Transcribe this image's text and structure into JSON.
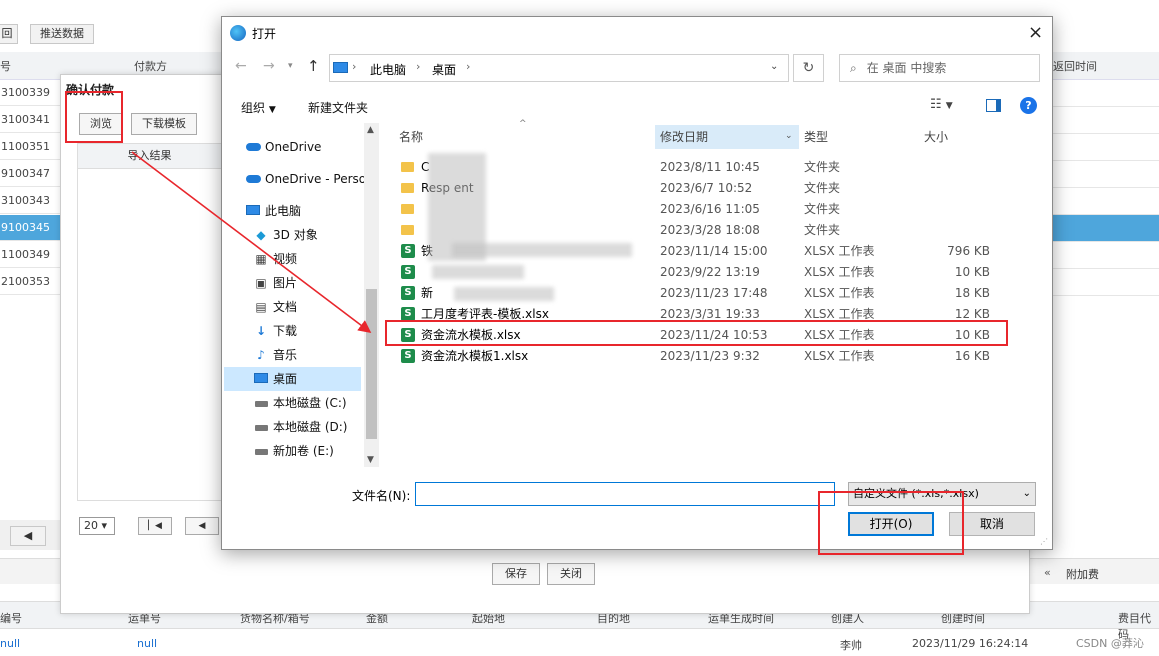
{
  "background": {
    "toolbar": {
      "back_label": "回",
      "push_label": "推送数据"
    },
    "header": {
      "col_no": "号",
      "col_payer": "付款方",
      "col_return_time": "返回时间"
    },
    "rows": [
      "3100339",
      "3100341",
      "1100351",
      "9100347",
      "3100343",
      "9100345",
      "1100349",
      "2100353"
    ],
    "selected_row_index": 5,
    "bottom_header": {
      "c1": "编号",
      "c2": "运单号",
      "c3": "货物名称/箱号",
      "c4": "金额",
      "c5": "起始地",
      "c6": "目的地",
      "c7": "运单生成时间",
      "c8": "创建人",
      "c9": "创建时间",
      "c10": "费目代码"
    },
    "bottom_row": {
      "c1": "null",
      "c2": "null",
      "creator": "李帅",
      "created": "2023/11/29 16:24:14"
    },
    "right_panel_label": "附加费",
    "watermark": "CSDN @莽沁"
  },
  "back_dialog": {
    "title": "确认付款",
    "browse_label": "浏览",
    "download_template_label": "下载模板",
    "import_result_label": "导入结果",
    "page_size": "20",
    "save_label": "保存",
    "close_label": "关闭"
  },
  "file_dialog": {
    "title": "打开",
    "breadcrumb": [
      "此电脑",
      "桌面"
    ],
    "search_placeholder": "在 桌面 中搜索",
    "organize_label": "组织",
    "new_folder_label": "新建文件夹",
    "nav": [
      {
        "icon": "onedrive-icon",
        "label": "OneDrive"
      },
      {
        "icon": "onedrive-icon",
        "label": "OneDrive - Perso"
      },
      {
        "icon": "computer-icon",
        "label": "此电脑"
      },
      {
        "icon": "cube-icon",
        "label": "3D 对象"
      },
      {
        "icon": "video-icon",
        "label": "视频"
      },
      {
        "icon": "picture-icon",
        "label": "图片"
      },
      {
        "icon": "document-icon",
        "label": "文档"
      },
      {
        "icon": "download-icon",
        "label": "下载"
      },
      {
        "icon": "music-icon",
        "label": "音乐"
      },
      {
        "icon": "desktop-icon",
        "label": "桌面"
      },
      {
        "icon": "drive-icon",
        "label": "本地磁盘 (C:)"
      },
      {
        "icon": "drive-icon",
        "label": "本地磁盘 (D:)"
      },
      {
        "icon": "drive-icon",
        "label": "新加卷 (E:)"
      }
    ],
    "selected_nav_index": 9,
    "columns": {
      "name": "名称",
      "modified": "修改日期",
      "type": "类型",
      "size": "大小"
    },
    "files": [
      {
        "kind": "folder",
        "name": "C",
        "modified": "2023/8/11 10:45",
        "type": "文件夹",
        "size": ""
      },
      {
        "kind": "folder",
        "name": "Resp        ent",
        "modified": "2023/6/7 10:52",
        "type": "文件夹",
        "size": ""
      },
      {
        "kind": "folder",
        "name": "",
        "modified": "2023/6/16 11:05",
        "type": "文件夹",
        "size": ""
      },
      {
        "kind": "folder",
        "name": "",
        "modified": "2023/3/28 18:08",
        "type": "文件夹",
        "size": ""
      },
      {
        "kind": "xlsx",
        "name": "铁",
        "modified": "2023/11/14 15:00",
        "type": "XLSX 工作表",
        "size": "796 KB"
      },
      {
        "kind": "xlsx",
        "name": "",
        "modified": "2023/9/22 13:19",
        "type": "XLSX 工作表",
        "size": "10 KB"
      },
      {
        "kind": "xlsx",
        "name": "新",
        "modified": "2023/11/23 17:48",
        "type": "XLSX 工作表",
        "size": "18 KB"
      },
      {
        "kind": "xlsx",
        "name": "工月度考评表-模板.xlsx",
        "modified": "2023/3/31 19:33",
        "type": "XLSX 工作表",
        "size": "12 KB"
      },
      {
        "kind": "xlsx",
        "name": "资金流水模板.xlsx",
        "modified": "2023/11/24 10:53",
        "type": "XLSX 工作表",
        "size": "10 KB"
      },
      {
        "kind": "xlsx",
        "name": "资金流水模板1.xlsx",
        "modified": "2023/11/23 9:32",
        "type": "XLSX 工作表",
        "size": "16 KB"
      }
    ],
    "filename_label": "文件名(N):",
    "filename_value": "",
    "filter_label": "自定义文件 (*.xls;*.xlsx)",
    "open_label": "打开(O)",
    "cancel_label": "取消"
  },
  "colors": {
    "annotation_red": "#e8262c",
    "selection_blue": "#4ea6dc",
    "nav_selection": "#cce8ff"
  }
}
